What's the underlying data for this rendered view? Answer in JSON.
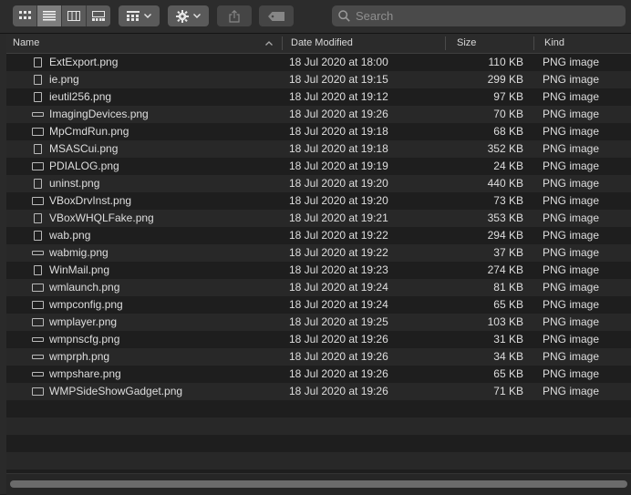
{
  "toolbar": {
    "view_buttons": [
      "icon-view",
      "list-view",
      "column-view",
      "gallery-view"
    ],
    "active_view": "list-view",
    "search_placeholder": "Search"
  },
  "columns": {
    "name": "Name",
    "date": "Date Modified",
    "size": "Size",
    "kind": "Kind"
  },
  "files": [
    {
      "name": "ExtExport.png",
      "date": "18 Jul 2020 at 18:00",
      "size": "110 KB",
      "kind": "PNG image"
    },
    {
      "name": "ie.png",
      "date": "18 Jul 2020 at 19:15",
      "size": "299 KB",
      "kind": "PNG image"
    },
    {
      "name": "ieutil256.png",
      "date": "18 Jul 2020 at 19:12",
      "size": "97 KB",
      "kind": "PNG image"
    },
    {
      "name": "ImagingDevices.png",
      "date": "18 Jul 2020 at 19:26",
      "size": "70 KB",
      "kind": "PNG image"
    },
    {
      "name": "MpCmdRun.png",
      "date": "18 Jul 2020 at 19:18",
      "size": "68 KB",
      "kind": "PNG image"
    },
    {
      "name": "MSASCui.png",
      "date": "18 Jul 2020 at 19:18",
      "size": "352 KB",
      "kind": "PNG image"
    },
    {
      "name": "PDIALOG.png",
      "date": "18 Jul 2020 at 19:19",
      "size": "24 KB",
      "kind": "PNG image"
    },
    {
      "name": "uninst.png",
      "date": "18 Jul 2020 at 19:20",
      "size": "440 KB",
      "kind": "PNG image"
    },
    {
      "name": "VBoxDrvInst.png",
      "date": "18 Jul 2020 at 19:20",
      "size": "73 KB",
      "kind": "PNG image"
    },
    {
      "name": "VBoxWHQLFake.png",
      "date": "18 Jul 2020 at 19:21",
      "size": "353 KB",
      "kind": "PNG image"
    },
    {
      "name": "wab.png",
      "date": "18 Jul 2020 at 19:22",
      "size": "294 KB",
      "kind": "PNG image"
    },
    {
      "name": "wabmig.png",
      "date": "18 Jul 2020 at 19:22",
      "size": "37 KB",
      "kind": "PNG image"
    },
    {
      "name": "WinMail.png",
      "date": "18 Jul 2020 at 19:23",
      "size": "274 KB",
      "kind": "PNG image"
    },
    {
      "name": "wmlaunch.png",
      "date": "18 Jul 2020 at 19:24",
      "size": "81 KB",
      "kind": "PNG image"
    },
    {
      "name": "wmpconfig.png",
      "date": "18 Jul 2020 at 19:24",
      "size": "65 KB",
      "kind": "PNG image"
    },
    {
      "name": "wmplayer.png",
      "date": "18 Jul 2020 at 19:25",
      "size": "103 KB",
      "kind": "PNG image"
    },
    {
      "name": "wmpnscfg.png",
      "date": "18 Jul 2020 at 19:26",
      "size": "31 KB",
      "kind": "PNG image"
    },
    {
      "name": "wmprph.png",
      "date": "18 Jul 2020 at 19:26",
      "size": "34 KB",
      "kind": "PNG image"
    },
    {
      "name": "wmpshare.png",
      "date": "18 Jul 2020 at 19:26",
      "size": "65 KB",
      "kind": "PNG image"
    },
    {
      "name": "WMPSideShowGadget.png",
      "date": "18 Jul 2020 at 19:26",
      "size": "71 KB",
      "kind": "PNG image"
    }
  ]
}
